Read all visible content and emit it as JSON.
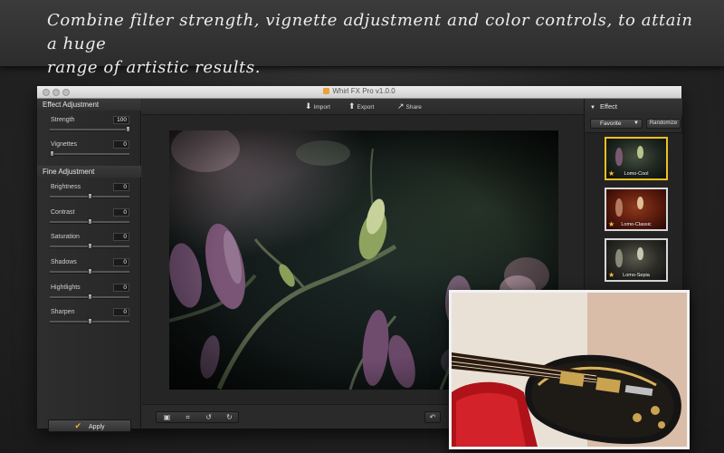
{
  "promo": {
    "line1": "Combine filter strength, vignette adjustment and color controls, to attain a huge",
    "line2": "range of artistic results."
  },
  "window": {
    "title": "Whirl FX Pro v1.0.0"
  },
  "left_panel": {
    "effect_header": "Effect Adjustment",
    "effect_sliders": [
      {
        "label": "Strength",
        "value": "100",
        "level": 1.0
      },
      {
        "label": "Vignettes",
        "value": "0",
        "level": 0.0
      }
    ],
    "fine_header": "Fine Adjustment",
    "fine_sliders": [
      {
        "label": "Brightness",
        "value": "0",
        "level": 0.5
      },
      {
        "label": "Contrast",
        "value": "0",
        "level": 0.5
      },
      {
        "label": "Saturation",
        "value": "0",
        "level": 0.5
      },
      {
        "label": "Shadows",
        "value": "0",
        "level": 0.5
      },
      {
        "label": "Hightlights",
        "value": "0",
        "level": 0.5
      },
      {
        "label": "Sharpen",
        "value": "0",
        "level": 0.5
      }
    ],
    "apply_label": "Apply"
  },
  "toolbar": {
    "import_label": "Import",
    "export_label": "Export",
    "share_label": "Share"
  },
  "right_panel": {
    "header": "Effect",
    "favorite_label": "Favorite",
    "randomize_label": "Randomize",
    "effects": [
      {
        "name": "Lomo-Cool",
        "selected": true
      },
      {
        "name": "Lomo-Classic",
        "selected": false
      },
      {
        "name": "Lomo-Sepia",
        "selected": false
      }
    ]
  },
  "colors": {
    "accent": "#f0c020",
    "star": "#f4c32a",
    "apply_check": "#f2b13b"
  }
}
